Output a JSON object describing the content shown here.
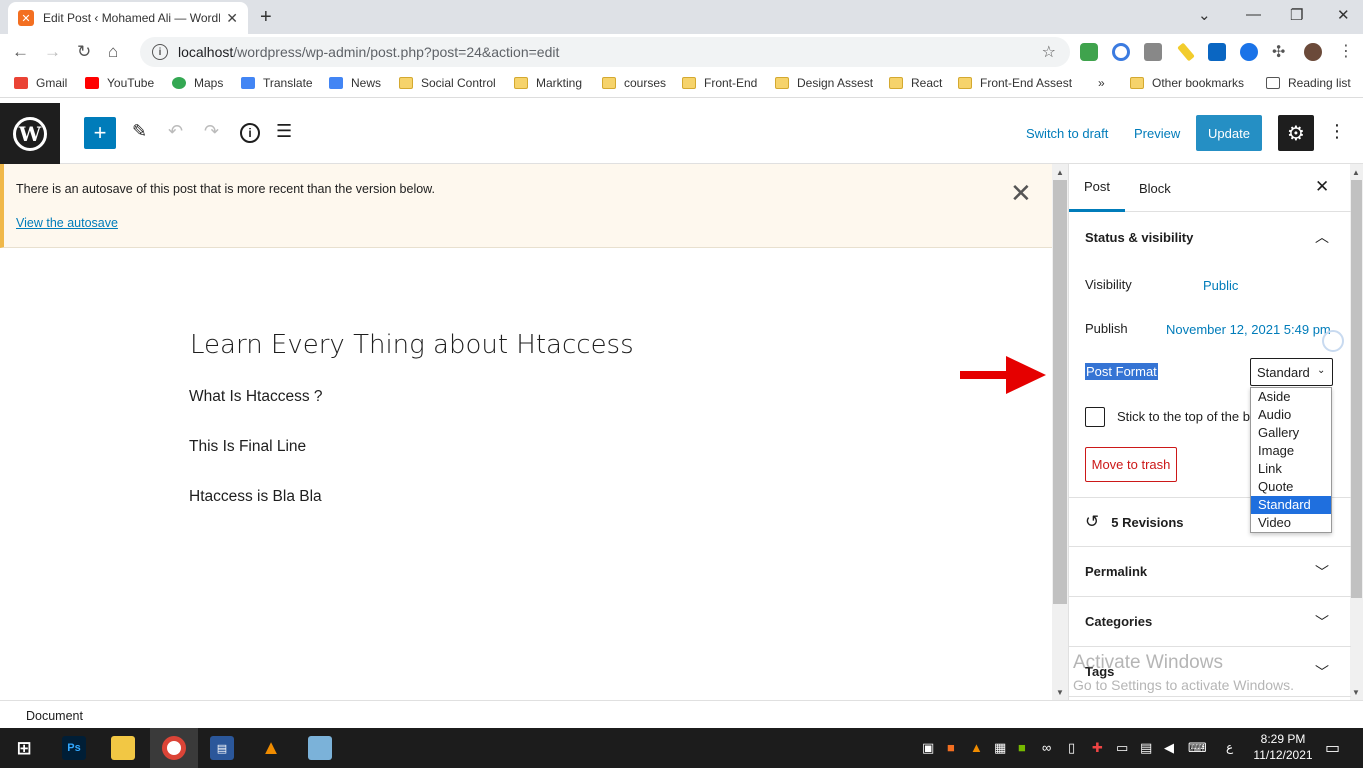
{
  "browser": {
    "tab_title": "Edit Post ‹ Mohamed Ali — WordPress",
    "url_host": "localhost",
    "url_path": "/wordpress/wp-admin/post.php?post=24&action=edit",
    "bookmarks": [
      "Gmail",
      "YouTube",
      "Maps",
      "Translate",
      "News",
      "Social Control",
      "Markting",
      "courses",
      "Front-End",
      "Design Assest",
      "React",
      "Front-End Assest"
    ],
    "other_bookmarks": "Other bookmarks",
    "reading_list": "Reading list",
    "more_bookmarks": "»"
  },
  "toolbar": {
    "switch_to_draft": "Switch to draft",
    "preview": "Preview",
    "update": "Update"
  },
  "notice": {
    "message": "There is an autosave of this post that is more recent than the version below.",
    "link": "View the autosave"
  },
  "post": {
    "title": "Learn Every Thing about Htaccess",
    "paragraphs": [
      "What Is Htaccess ?",
      "This Is Final Line",
      "Htaccess is Bla Bla"
    ]
  },
  "sidebar": {
    "tab_post": "Post",
    "tab_block": "Block",
    "status_visibility": "Status & visibility",
    "visibility_label": "Visibility",
    "visibility_value": "Public",
    "publish_label": "Publish",
    "publish_value": "November 12, 2021 5:49 pm",
    "post_format_label": "Post Format",
    "post_format_value": "Standard",
    "post_format_options": [
      "Aside",
      "Audio",
      "Gallery",
      "Image",
      "Link",
      "Quote",
      "Standard",
      "Video"
    ],
    "stick_label": "Stick to the top of the blog",
    "move_to_trash": "Move to trash",
    "revisions": "5 Revisions",
    "permalink": "Permalink",
    "categories": "Categories",
    "tags": "Tags"
  },
  "watermark": {
    "line1": "Activate Windows",
    "line2": "Go to Settings to activate Windows."
  },
  "footer": {
    "breadcrumb": "Document"
  },
  "taskbar": {
    "time": "8:29 PM",
    "date": "11/12/2021",
    "lang": "ع"
  }
}
